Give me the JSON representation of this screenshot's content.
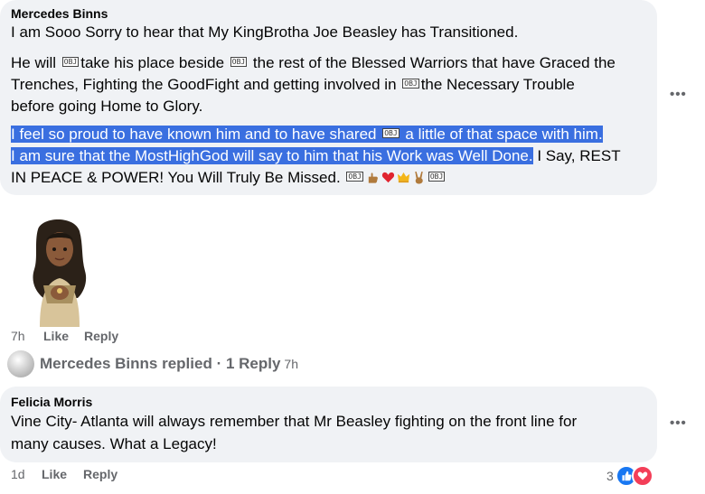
{
  "comment1": {
    "author": "Mercedes Binns",
    "p1": "I am Sooo Sorry to hear that My KingBrotha Joe Beasley has Transitioned.",
    "p2_a": "He will ",
    "p2_b": "take his place beside ",
    "p2_c": " the rest of the Blessed Warriors that have Graced the",
    "p2_line2_a": "Trenches, Fighting the GoodFight and getting involved in ",
    "p2_line2_b": "the Necessary Trouble",
    "p2_line3": "before going Home to Glory.",
    "p3_hl1_a": "I feel so proud to have known him and to have shared ",
    "p3_hl1_b": " a little of that space with him.",
    "p3_hl2": "I am sure that the MostHighGod will say to him that his Work was Well Done.",
    "p3_rest": " I Say, REST",
    "p3_line3": "IN PEACE & POWER! You Will Truly Be Missed. ",
    "obj_label": "OBJ",
    "time": "7h",
    "like": "Like",
    "reply": "Reply",
    "more": "•••"
  },
  "replies_summary": {
    "text": "Mercedes Binns replied · 1 Reply",
    "time": "7h"
  },
  "comment2": {
    "author": "Felicia Morris",
    "line1": "Vine City- Atlanta will always remember that Mr Beasley fighting on the front line for",
    "line2": "many causes. What a Legacy!",
    "time": "1d",
    "like": "Like",
    "reply": "Reply",
    "reaction_count": "3",
    "more": "•••"
  },
  "icons": [
    "thumb-emoji",
    "heart-emoji",
    "crown-emoji",
    "victory-hand-emoji",
    "like-reaction-icon",
    "love-reaction-icon",
    "sticker-avatar"
  ],
  "colors": {
    "highlight": "#3a6fe0",
    "bubble": "#f0f2f5",
    "meta": "#65676b",
    "like_blue": "#1877f2",
    "love_red": "#f33e58"
  }
}
